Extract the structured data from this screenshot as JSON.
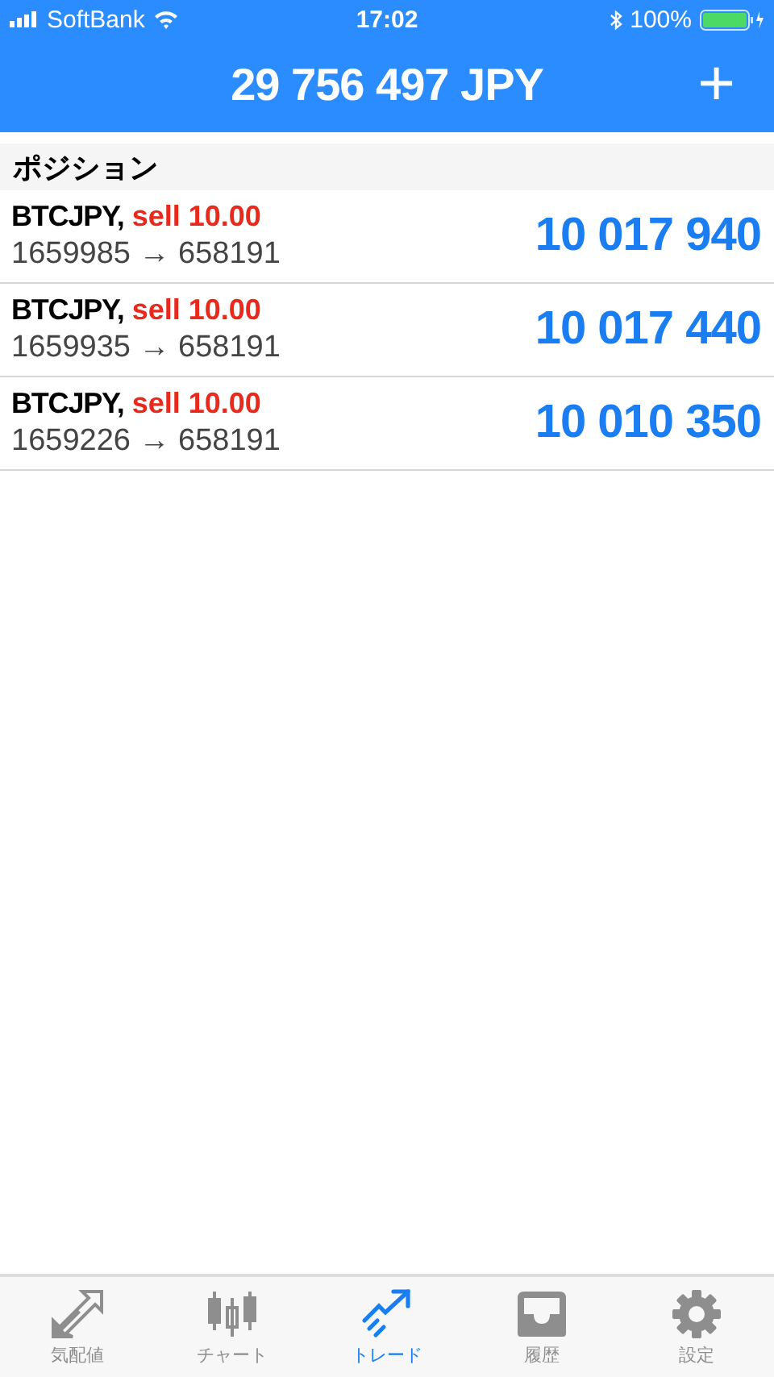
{
  "status_bar": {
    "carrier": "SoftBank",
    "time": "17:02",
    "battery": "100%"
  },
  "header": {
    "title": "29 756 497 JPY",
    "add": "+"
  },
  "section": {
    "title": "ポジション"
  },
  "positions": [
    {
      "symbol": "BTCJPY,",
      "side": "sell 10.00",
      "prices": "1659985 → 658191",
      "profit": "10 017 940"
    },
    {
      "symbol": "BTCJPY,",
      "side": "sell 10.00",
      "prices": "1659935 → 658191",
      "profit": "10 017 440"
    },
    {
      "symbol": "BTCJPY,",
      "side": "sell 10.00",
      "prices": "1659226 → 658191",
      "profit": "10 010 350"
    }
  ],
  "tabs": [
    {
      "kind": "quotes",
      "label": "気配値",
      "selected": false
    },
    {
      "kind": "chart",
      "label": "チャート",
      "selected": false
    },
    {
      "kind": "trade",
      "label": "トレード",
      "selected": true
    },
    {
      "kind": "history",
      "label": "履歴",
      "selected": false
    },
    {
      "kind": "settings",
      "label": "設定",
      "selected": false
    }
  ]
}
